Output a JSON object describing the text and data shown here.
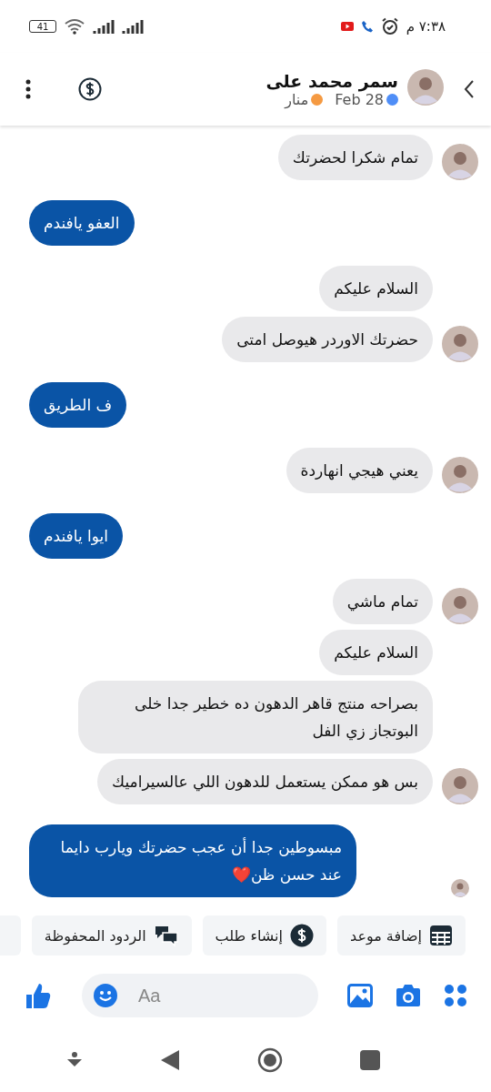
{
  "status_bar": {
    "time": "٧:٣٨ م",
    "battery": "41"
  },
  "header": {
    "name": "سمر محمد على",
    "date": "Feb 28",
    "agent": "منار"
  },
  "messages": [
    {
      "kind": "incoming",
      "text": "تمام شكرا لحضرتك",
      "avatar": true
    },
    {
      "kind": "outgoing",
      "text": "العفو يافندم",
      "seen": false
    },
    {
      "kind": "incoming",
      "text": "السلام عليكم",
      "avatar": false
    },
    {
      "kind": "incoming",
      "text": "حضرتك الاوردر هيوصل امتى",
      "avatar": true
    },
    {
      "kind": "outgoing",
      "text": "ف الطريق",
      "seen": false
    },
    {
      "kind": "incoming",
      "text": "يعني هيجي انهاردة",
      "avatar": true
    },
    {
      "kind": "outgoing",
      "text": "ايوا يافندم",
      "seen": false
    },
    {
      "kind": "incoming",
      "text": "تمام ماشي",
      "avatar": true
    },
    {
      "kind": "incoming",
      "text": "السلام عليكم",
      "avatar": false
    },
    {
      "kind": "incoming",
      "text": "بصراحه منتج قاهر الدهون ده خطير جدا خلى البوتجاز زي الفل",
      "avatar": false
    },
    {
      "kind": "incoming",
      "text": "بس هو ممكن يستعمل للدهون اللي عالسيراميك",
      "avatar": true
    },
    {
      "kind": "outgoing",
      "text": "مبسوطين جدا أن عجب حضرتك ويارب دايما عند حسن ظن❤️",
      "seen": true
    }
  ],
  "quick_replies": [
    {
      "kind": "calendar",
      "label": "إضافة موعد"
    },
    {
      "kind": "order",
      "label": "إنشاء طلب"
    },
    {
      "kind": "saved",
      "label": "الردود المحفوظة"
    },
    {
      "kind": "more"
    }
  ],
  "composer": {
    "placeholder": "Aa"
  }
}
